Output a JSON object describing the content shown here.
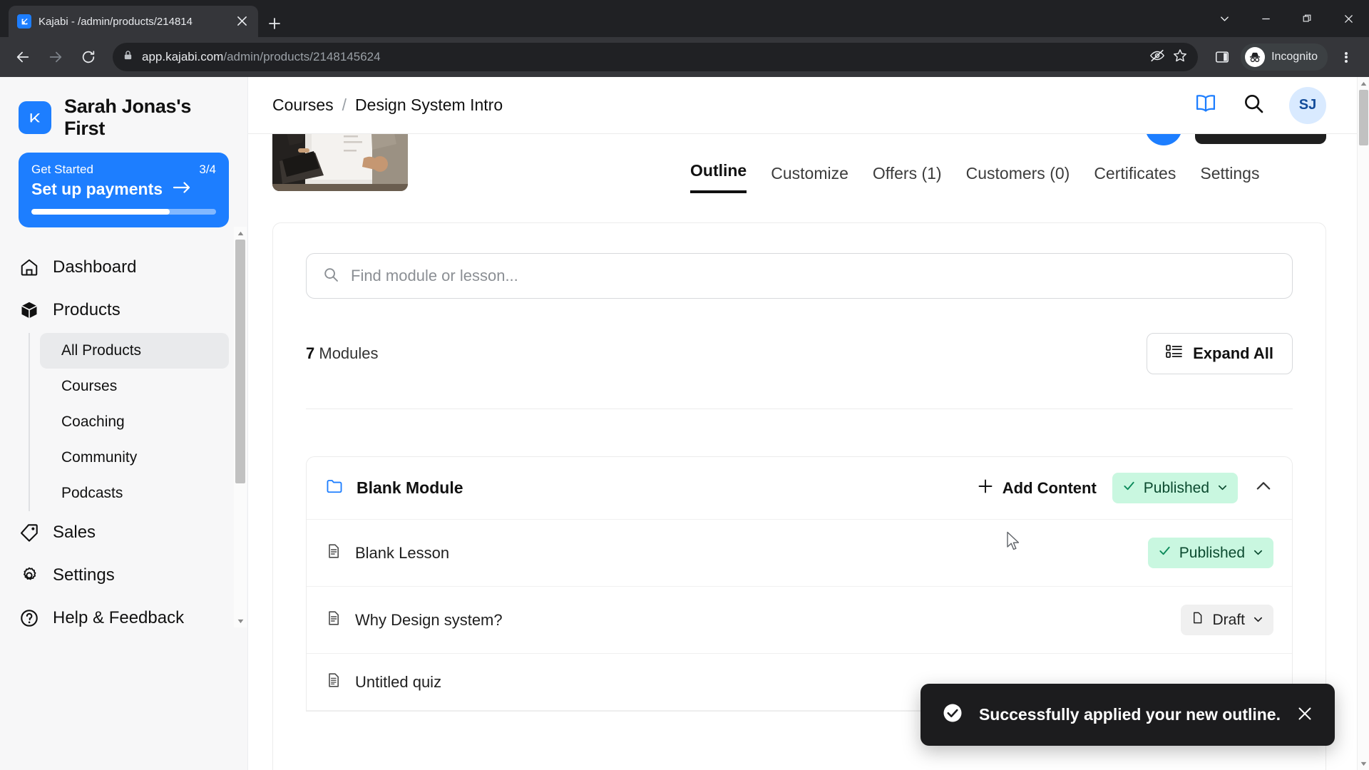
{
  "browser": {
    "tab": {
      "title": "Kajabi - /admin/products/214814",
      "favicon_icon": "kajabi-logo-icon",
      "close_icon": "close-icon"
    },
    "new_tab_icon": "plus-icon",
    "window_controls": [
      {
        "name": "chevron-down-button",
        "icon": "chevron-down-icon"
      },
      {
        "name": "minimize-button",
        "icon": "minimize-icon"
      },
      {
        "name": "maximize-button",
        "icon": "maximize-icon"
      },
      {
        "name": "close-window-button",
        "icon": "close-icon"
      }
    ],
    "nav": {
      "back_icon": "arrow-left-icon",
      "forward_icon": "arrow-right-icon",
      "reload_icon": "reload-icon"
    },
    "omnibox": {
      "lock_icon": "lock-icon",
      "url_host": "app.kajabi.com",
      "url_path": "/admin/products/2148145624",
      "tracking_icon": "eye-slash-icon",
      "bookmark_icon": "star-icon",
      "sidepanel_icon": "side-panel-icon",
      "incognito_label": "Incognito",
      "incognito_icon": "incognito-icon",
      "menu_icon": "three-dot-menu-icon"
    }
  },
  "sidebar": {
    "brand": {
      "name": "Sarah Jonas's First",
      "logo_icon": "kajabi-logo-icon"
    },
    "get_started": {
      "label": "Get Started",
      "progress_text": "3/4",
      "cta": "Set up payments",
      "arrow_icon": "arrow-right-icon",
      "progress_percent": 75
    },
    "items": [
      {
        "label": "Dashboard",
        "icon": "home-icon"
      },
      {
        "label": "Products",
        "icon": "box-icon"
      },
      {
        "label": "Sales",
        "icon": "tag-icon"
      },
      {
        "label": "Settings",
        "icon": "gear-icon"
      },
      {
        "label": "Help & Feedback",
        "icon": "question-circle-icon"
      }
    ],
    "product_subitems": [
      {
        "label": "All Products",
        "active": true
      },
      {
        "label": "Courses",
        "active": false
      },
      {
        "label": "Coaching",
        "active": false
      },
      {
        "label": "Community",
        "active": false
      },
      {
        "label": "Podcasts",
        "active": false
      }
    ]
  },
  "header": {
    "breadcrumb": {
      "parent": "Courses",
      "separator": "/",
      "current": "Design System Intro"
    },
    "book_icon": "book-icon",
    "search_icon": "search-icon",
    "avatar_initials": "SJ"
  },
  "tabs": [
    {
      "label": "Outline",
      "active": true
    },
    {
      "label": "Customize",
      "active": false
    },
    {
      "label": "Offers (1)",
      "active": false
    },
    {
      "label": "Customers (0)",
      "active": false
    },
    {
      "label": "Certificates",
      "active": false
    },
    {
      "label": "Settings",
      "active": false
    }
  ],
  "outline": {
    "search": {
      "placeholder": "Find module or lesson...",
      "value": "",
      "icon": "search-icon"
    },
    "modules_count_number": "7",
    "modules_count_label": "Modules",
    "expand_all": {
      "label": "Expand All",
      "icon": "expand-list-icon"
    },
    "module": {
      "title": "Blank Module",
      "folder_icon": "folder-icon",
      "add_content": {
        "label": "Add Content",
        "icon": "plus-icon"
      },
      "status": {
        "label": "Published",
        "icon": "check-icon",
        "chevron": "chevron-down-icon"
      },
      "collapse_icon": "chevron-up-icon"
    },
    "lessons": [
      {
        "title": "Blank Lesson",
        "icon": "document-icon",
        "status": "Published",
        "status_type": "published",
        "status_icon": "check-icon"
      },
      {
        "title": "Why Design system?",
        "icon": "document-icon",
        "status": "Draft",
        "status_type": "draft",
        "status_icon": "file-icon"
      },
      {
        "title": "Untitled quiz",
        "icon": "quiz-document-icon",
        "status": "",
        "status_type": "none",
        "status_icon": ""
      }
    ]
  },
  "toast": {
    "message": "Successfully applied your new outline.",
    "check_icon": "check-circle-icon",
    "close_icon": "close-icon"
  },
  "colors": {
    "brand_blue": "#1d7eff",
    "published_bg": "#c9f7e0",
    "toast_bg": "#1c1c1e",
    "chrome_dark": "#35363a"
  }
}
